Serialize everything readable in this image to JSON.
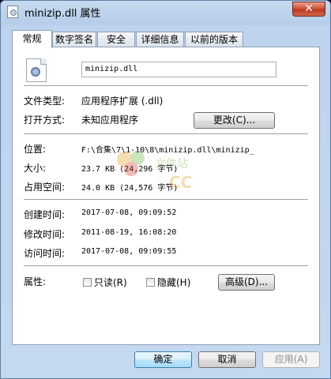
{
  "window": {
    "title": "minizip.dll 属性",
    "close_glyph": "✕"
  },
  "tabs": [
    {
      "label": "常规",
      "active": true
    },
    {
      "label": "数字签名",
      "active": false
    },
    {
      "label": "安全",
      "active": false
    },
    {
      "label": "详细信息",
      "active": false
    },
    {
      "label": "以前的版本",
      "active": false
    }
  ],
  "general": {
    "file_name": "minizip.dll",
    "type_label": "文件类型:",
    "type_value": "应用程序扩展 (.dll)",
    "opens_with_label": "打开方式:",
    "opens_with_value": "未知应用程序",
    "change_button": "更改(C)...",
    "location_label": "位置:",
    "location_value": "F:\\合集\\7\\1-10\\8\\minizip.dll\\minizip_",
    "size_label": "大小:",
    "size_value": "23.7 KB (24,296 字节)",
    "size_on_disk_label": "占用空间:",
    "size_on_disk_value": "24.0 KB (24,576 字节)",
    "created_label": "创建时间:",
    "created_value": "2017-07-08, 09:09:52",
    "modified_label": "修改时间:",
    "modified_value": "2011-08-19, 16:08:20",
    "accessed_label": "访问时间:",
    "accessed_value": "2017-07-08, 09:09:55",
    "attributes_label": "属性:",
    "readonly_label": "只读(R)",
    "hidden_label": "隐藏(H)",
    "advanced_button": "高级(D)..."
  },
  "footer": {
    "ok": "确定",
    "cancel": "取消",
    "apply": "应用(A)"
  },
  "watermark": {
    "text_top": "文件站",
    "text_bottom": "CC"
  },
  "colors": {
    "title_bar": "#bdd3ee",
    "close_button": "#cf4b2f",
    "default_button_border": "#3c7fb1"
  }
}
